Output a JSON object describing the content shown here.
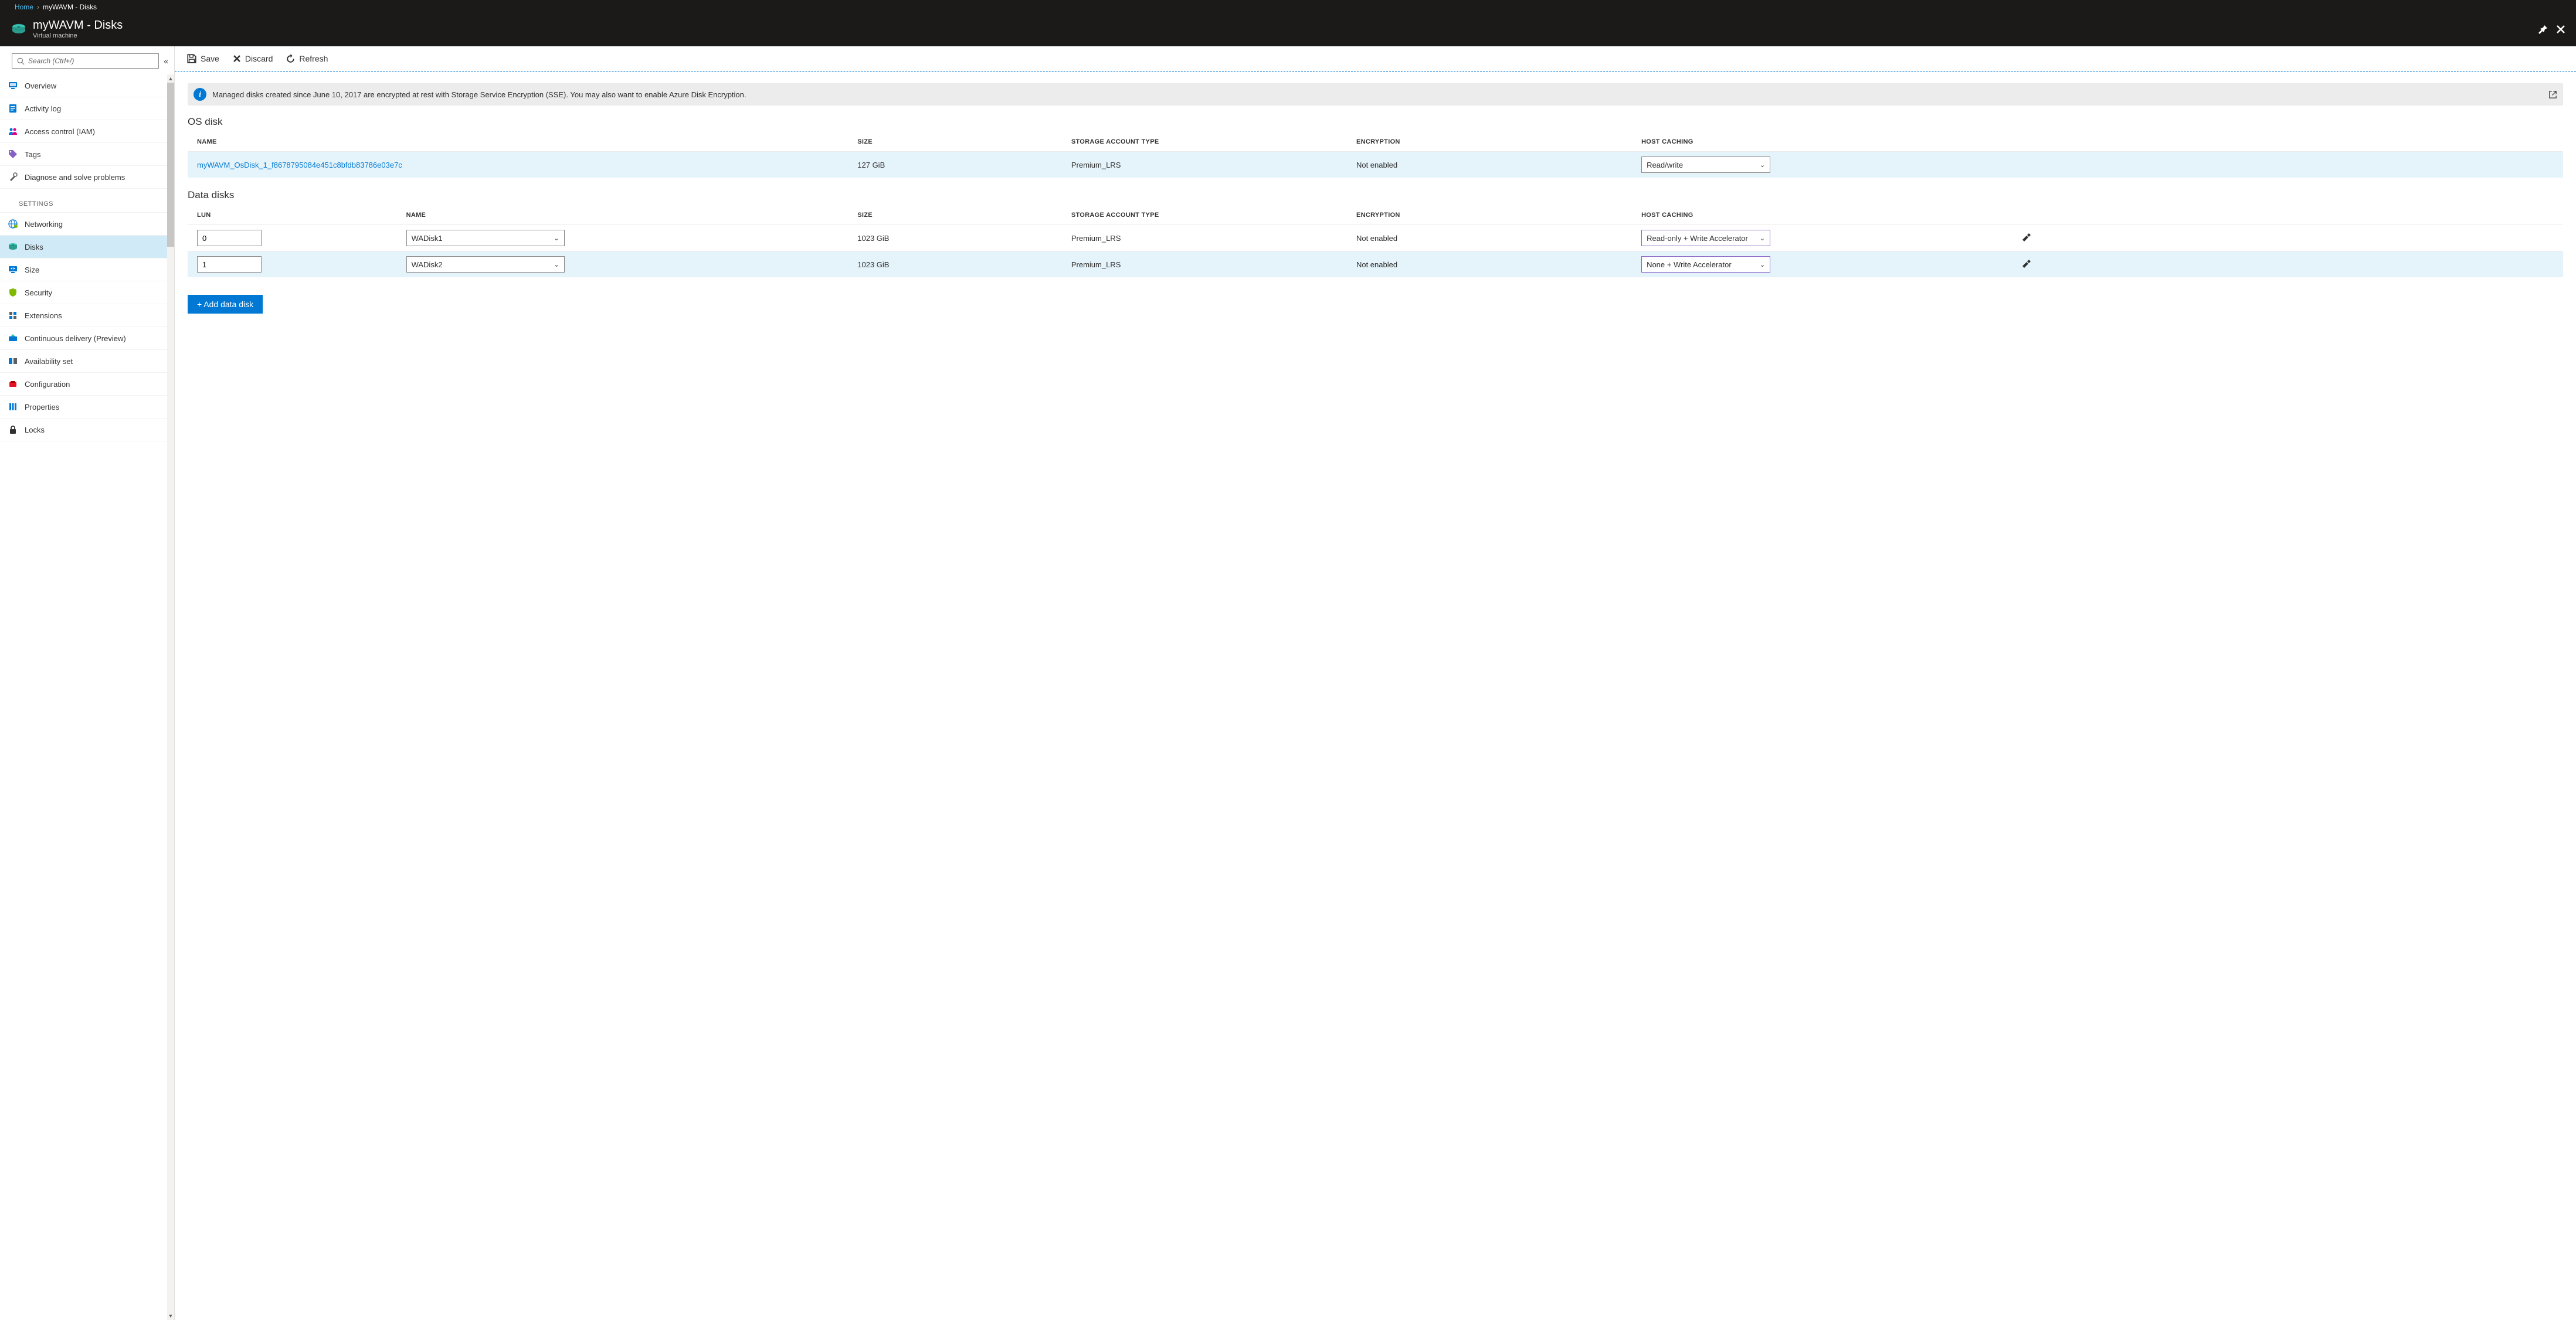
{
  "breadcrumb": {
    "home": "Home",
    "current": "myWAVM - Disks"
  },
  "header": {
    "title": "myWAVM - Disks",
    "subtitle": "Virtual machine"
  },
  "search": {
    "placeholder": "Search (Ctrl+/)"
  },
  "nav": {
    "items": [
      {
        "label": "Overview"
      },
      {
        "label": "Activity log"
      },
      {
        "label": "Access control (IAM)"
      },
      {
        "label": "Tags"
      },
      {
        "label": "Diagnose and solve problems"
      }
    ],
    "settings_label": "SETTINGS",
    "settings": [
      {
        "label": "Networking"
      },
      {
        "label": "Disks"
      },
      {
        "label": "Size"
      },
      {
        "label": "Security"
      },
      {
        "label": "Extensions"
      },
      {
        "label": "Continuous delivery (Preview)"
      },
      {
        "label": "Availability set"
      },
      {
        "label": "Configuration"
      },
      {
        "label": "Properties"
      },
      {
        "label": "Locks"
      }
    ]
  },
  "toolbar": {
    "save": "Save",
    "discard": "Discard",
    "refresh": "Refresh"
  },
  "banner": {
    "text": "Managed disks created since June 10, 2017 are encrypted at rest with Storage Service Encryption (SSE). You may also want to enable Azure Disk Encryption."
  },
  "os_disk": {
    "title": "OS disk",
    "headers": {
      "name": "NAME",
      "size": "SIZE",
      "storage": "STORAGE ACCOUNT TYPE",
      "encryption": "ENCRYPTION",
      "caching": "HOST CACHING"
    },
    "row": {
      "name": "myWAVM_OsDisk_1_f8678795084e451c8bfdb83786e03e7c",
      "size": "127 GiB",
      "storage": "Premium_LRS",
      "encryption": "Not enabled",
      "caching": "Read/write"
    }
  },
  "data_disks": {
    "title": "Data disks",
    "headers": {
      "lun": "LUN",
      "name": "NAME",
      "size": "SIZE",
      "storage": "STORAGE ACCOUNT TYPE",
      "encryption": "ENCRYPTION",
      "caching": "HOST CACHING"
    },
    "rows": [
      {
        "lun": "0",
        "name": "WADisk1",
        "size": "1023 GiB",
        "storage": "Premium_LRS",
        "encryption": "Not enabled",
        "caching": "Read-only + Write Accelerator"
      },
      {
        "lun": "1",
        "name": "WADisk2",
        "size": "1023 GiB",
        "storage": "Premium_LRS",
        "encryption": "Not enabled",
        "caching": "None + Write Accelerator"
      }
    ],
    "add_button": "+ Add data disk"
  }
}
